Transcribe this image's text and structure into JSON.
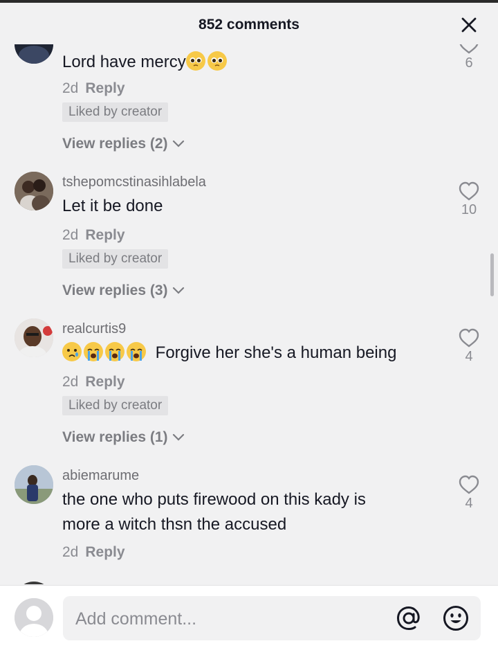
{
  "header": {
    "title": "852 comments"
  },
  "comments": [
    {
      "username": "",
      "text": "Lord have mercy",
      "emojis_after": [
        "pleading-face-emoji",
        "pleading-face-emoji"
      ],
      "time": "2d",
      "reply_label": "Reply",
      "liked_by_creator": "Liked by creator",
      "view_replies": "View replies (2)",
      "like_count": "6"
    },
    {
      "username": "tshepomcstinasihlabela",
      "text": "Let it be done",
      "time": "2d",
      "reply_label": "Reply",
      "liked_by_creator": "Liked by creator",
      "view_replies": "View replies (3)",
      "like_count": "10"
    },
    {
      "username": "realcurtis9",
      "emojis_before": [
        "crying-face-emoji",
        "loudly-crying-face-emoji",
        "loudly-crying-face-emoji",
        "loudly-crying-face-emoji"
      ],
      "text": "Forgive her she's a human being",
      "time": "2d",
      "reply_label": "Reply",
      "liked_by_creator": "Liked by creator",
      "view_replies": "View replies (1)",
      "like_count": "4"
    },
    {
      "username": "abiemarume",
      "text_line1": "the one who puts firewood on this kady is",
      "text_line2": "more a witch thsn the accused",
      "time": "2d",
      "reply_label": "Reply",
      "like_count": "4"
    }
  ],
  "footer": {
    "placeholder": "Add comment..."
  },
  "icons": {
    "close": "close-icon",
    "heart": "heart-outline-icon",
    "chevron": "chevron-down-icon",
    "mention": "at-sign-icon",
    "emoji": "smiley-icon"
  },
  "colors": {
    "background": "#f1f1f2",
    "primary_text": "#161823",
    "secondary_text": "#8a8b91",
    "tag_background": "#e3e3e5"
  }
}
